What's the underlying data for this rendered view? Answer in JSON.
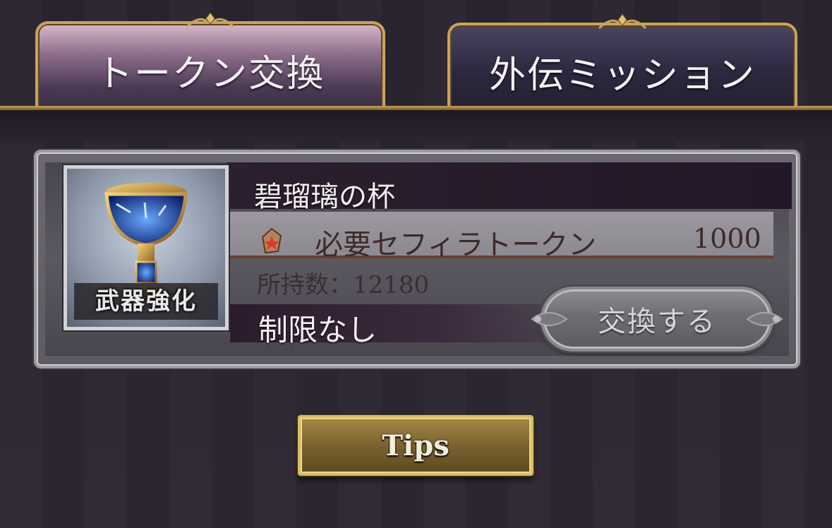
{
  "tabs": [
    {
      "label": "トークン交換",
      "active": true
    },
    {
      "label": "外伝ミッション",
      "active": false
    }
  ],
  "item": {
    "icon": "golden-chalice-icon",
    "icon_tag": "武器強化",
    "name": "碧瑠璃の杯",
    "cost_label": "必要セフィラトークン",
    "cost_value": "1000",
    "owned_label": "所持数：",
    "owned_value": "12180",
    "limit": "制限なし",
    "exchange_label": "交換する"
  },
  "tips_label": "Tips",
  "colors": {
    "gold_border": "#c9a35a",
    "active_tab_top": "#d8b9c8",
    "card_border": "#9d9aa2",
    "cost_text": "#3e2a28"
  }
}
